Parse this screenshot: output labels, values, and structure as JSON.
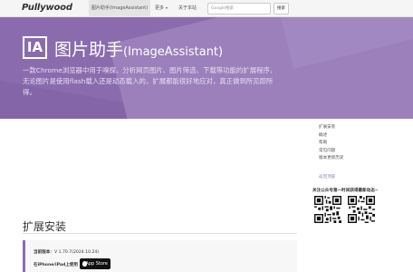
{
  "navbar": {
    "logo": "Pullywood",
    "active_item": "图片助手(ImageAssistant)",
    "more_label": "更多",
    "about_label": "关于本站",
    "search_placeholder": "Google搜索",
    "search_button": "搜索"
  },
  "hero": {
    "logo_text": "IA",
    "title_cn": "图片助手",
    "title_en": "(ImageAssistant)",
    "description": "一款Chrome浏览器中用于嗅探、分析网页图片、图片筛选、下载等功能的扩展程序，无论图片是使用flash载入还是动态载入的，扩展都能很好地应对，真正做到所见即所得。"
  },
  "main": {
    "section_title": "扩展安装",
    "version_label": "当前版本",
    "version_value": "：V 1.70.7(2024.10.24)",
    "ios_label": "在iPhone/iPad上使用",
    "appstore_label": "App Store"
  },
  "sidebar": {
    "items": [
      {
        "label": "扩展安装"
      },
      {
        "label": "概述"
      },
      {
        "label": "帮助"
      },
      {
        "label": "常见问题"
      },
      {
        "label": "版本更新历史"
      }
    ],
    "back_to_top": "返回顶部",
    "follow_text": "关注公众号第一时间获得最新动态~"
  },
  "colors": {
    "hero_purple": "#8a6cae",
    "accent_border": "#8a6cae"
  }
}
